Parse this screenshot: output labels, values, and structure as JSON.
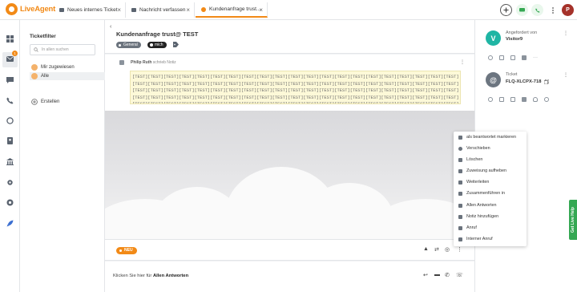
{
  "app": {
    "logo_text": "LiveAgent",
    "brand_color": "#f28a17",
    "user_initial": "P",
    "user_avatar_color": "#a5322a"
  },
  "tabs": [
    {
      "label": "Neues internes Ticket",
      "icon": "envelope-icon"
    },
    {
      "label": "Nachricht verfassen",
      "icon": "envelope-icon"
    },
    {
      "label": "Kundenanfrage trust...",
      "icon": "ticket-dot-icon",
      "active": true
    }
  ],
  "topbar_icons": [
    "add-icon",
    "chat-icon",
    "phone-icon",
    "more-icon"
  ],
  "sidebar_icons": [
    "dashboard-icon",
    "tickets-icon",
    "chat-icon",
    "calls-icon",
    "reports-icon",
    "contacts-icon",
    "knowledgebase-icon",
    "settings-icon",
    "plugins-icon",
    "rocket-icon"
  ],
  "sidebar_badge": "1",
  "filter": {
    "title": "Ticketfilter",
    "search_placeholder": "In allen suchen",
    "items": [
      {
        "label": "Mir zugewiesen"
      },
      {
        "label": "Alle",
        "active": true
      }
    ],
    "create_label": "Erstellen"
  },
  "ticket": {
    "subject": "Kundenanfrage trust@ TEST",
    "department_tag": "General",
    "status_tag": "mich",
    "author_line": {
      "author": "Philip Ruth",
      "suffix": "schrieb Notiz"
    },
    "note_body": "[TEST][TEST][TEST][TEST][TEST][TEST][TEST][TEST][TEST][TEST][TEST][TEST][TEST][TEST][TEST][TEST][TEST][TEST][TEST][TEST][TEST][TEST][TEST][TEST][TEST][TEST][TEST][TEST][TEST][TEST][TEST][TEST][TEST][TEST][TEST][TEST][TEST][TEST][TEST][TEST][TEST][TEST][TEST][TEST][TEST][TEST][TEST][TEST][TEST][TEST][TEST][TEST][TEST][TEST][TEST][TEST][TEST][TEST][TEST][TEST][TEST][TEST][TEST][TEST][TEST][TEST][TEST][TEST][TEST][TEST][TEST][TEST][TEST][TEST][TEST][TEST][TEST][TEST][TEST][TEST][TEST][TEST][TEST][TEST][TEST][TEST][TEST][TEST][TEST][TEST][TEST][TEST][TEST][TEST][TEST][TEST][TEST][TEST][TEST][TEST][TEST][TEST][TEST][TEST][TEST][TEST][TEST][TEST][TEST][TEST][TEST]",
    "status_label": "NEU",
    "reply_prompt": "Klicken Sie hier für",
    "reply_action": "Allen Antworten"
  },
  "requester": {
    "label": "Angefordert von",
    "name": "Visitor9",
    "initial": "V",
    "avatar_color": "#1fb5a4"
  },
  "ticket_info": {
    "label": "Ticket",
    "code": "FLQ-XLCPX-718",
    "initial": "@",
    "avatar_color": "#6c7580"
  },
  "menu": {
    "items": [
      {
        "label": "als beantwortet markieren",
        "icon": "check-icon"
      },
      {
        "label": "Verschieben",
        "icon": "move-icon"
      },
      {
        "label": "Löschen",
        "icon": "trash-icon"
      },
      {
        "label": "Zuweisung aufheben",
        "icon": "unassign-icon"
      },
      {
        "label": "Weiterleiten",
        "icon": "forward-icon"
      },
      {
        "label": "Zusammenführen in",
        "icon": "merge-icon"
      },
      {
        "label": "Allen Antworten",
        "icon": "reply-all-icon"
      },
      {
        "label": "Notiz hinzufügen",
        "icon": "note-icon"
      },
      {
        "label": "Anruf",
        "icon": "phone-icon"
      },
      {
        "label": "Interner Anruf",
        "icon": "internal-call-icon"
      }
    ]
  },
  "get_help_label": "Get Live Help"
}
